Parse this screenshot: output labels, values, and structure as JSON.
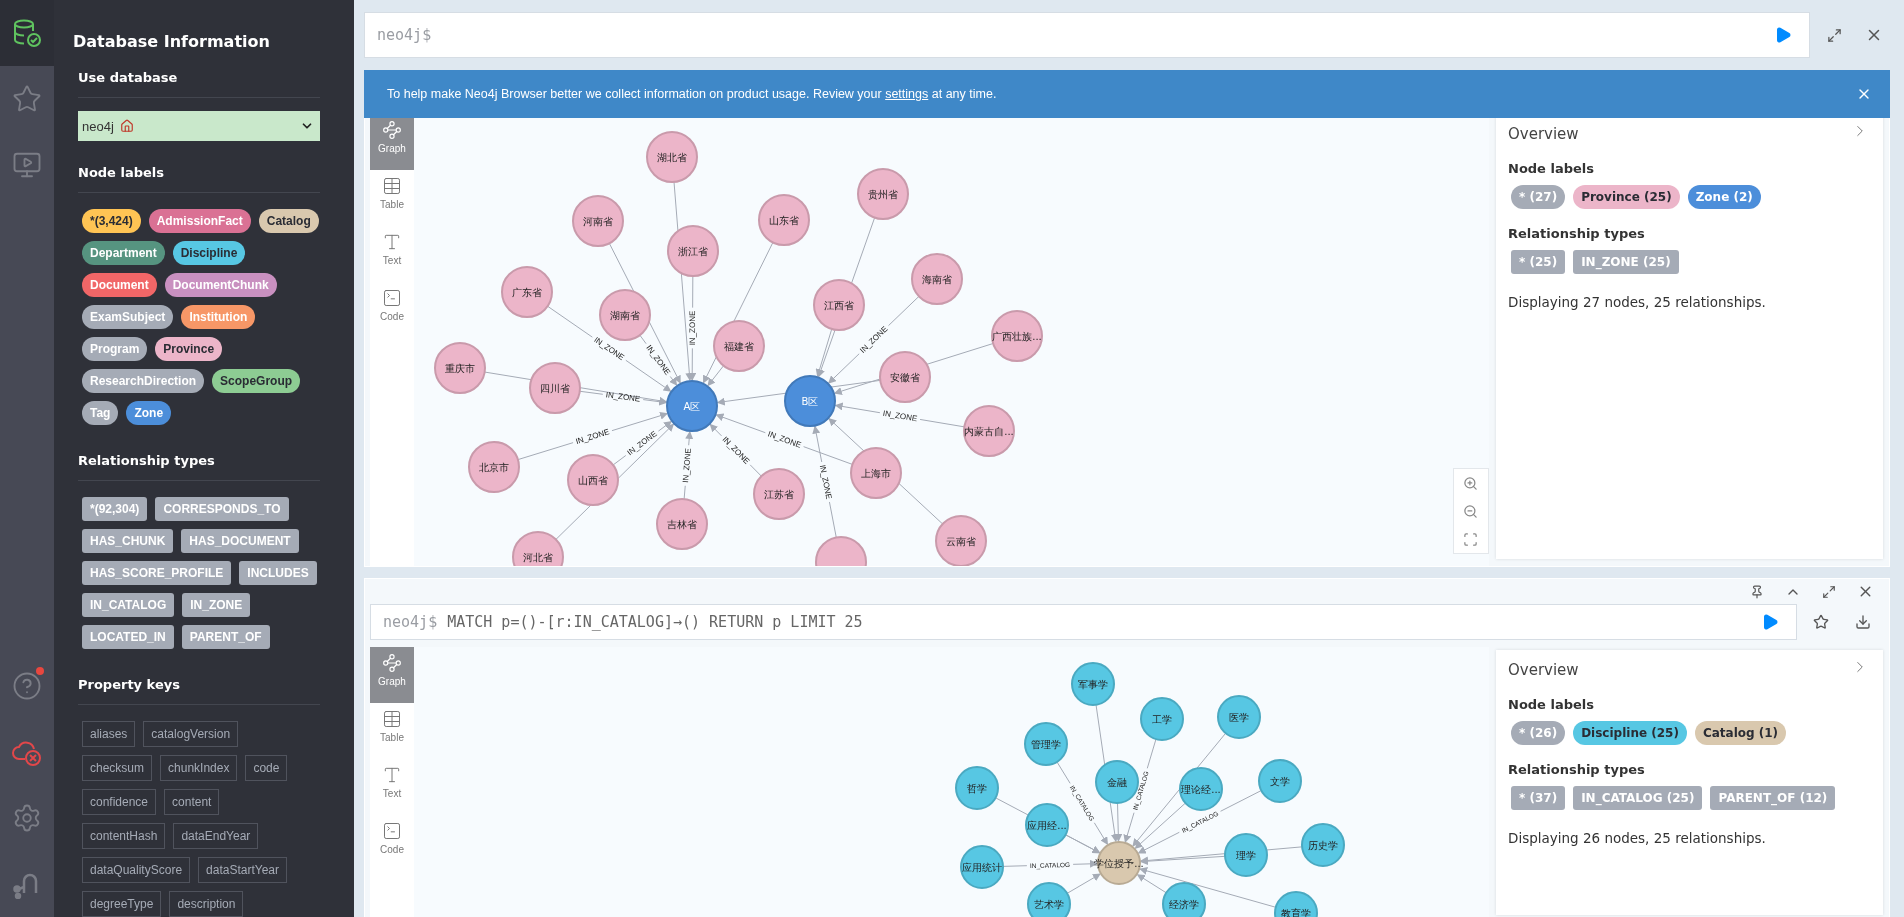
{
  "nav_items": [
    {
      "kind": "database",
      "selected": true,
      "notification": false
    },
    {
      "kind": "favorites",
      "selected": false,
      "notification": false
    },
    {
      "kind": "guides",
      "selected": false,
      "notification": false
    },
    {
      "kind": "help",
      "selected": false,
      "notification": true
    },
    {
      "kind": "connection",
      "selected": false,
      "notification": false
    },
    {
      "kind": "settings",
      "selected": false,
      "notification": false
    },
    {
      "kind": "sandbox",
      "selected": false,
      "notification": false
    }
  ],
  "drawer": {
    "title": "Database Information",
    "use_database": {
      "heading": "Use database",
      "value": "neo4j"
    },
    "node_labels": {
      "heading": "Node labels",
      "items": [
        {
          "label": "*(3,424)",
          "color": "#ffc454"
        },
        {
          "label": "AdmissionFact",
          "color": "#da7194"
        },
        {
          "label": "Catalog",
          "color": "#d9c8ae"
        },
        {
          "label": "Department",
          "color": "#569480"
        },
        {
          "label": "Discipline",
          "color": "#57c7e3"
        },
        {
          "label": "Document",
          "color": "#f16667"
        },
        {
          "label": "DocumentChunk",
          "color": "#c990c0"
        },
        {
          "label": "ExamSubject",
          "color": "#a5abb6"
        },
        {
          "label": "Institution",
          "color": "#f79767"
        },
        {
          "label": "Program",
          "color": "#a5abb6"
        },
        {
          "label": "Province",
          "color": "#ecb5c9"
        },
        {
          "label": "ResearchDirection",
          "color": "#a5abb6"
        },
        {
          "label": "ScopeGroup",
          "color": "#8dcc93"
        },
        {
          "label": "Tag",
          "color": "#a5abb6"
        },
        {
          "label": "Zone",
          "color": "#4c8eda"
        }
      ]
    },
    "relationship_types": {
      "heading": "Relationship types",
      "items": [
        "*(92,304)",
        "CORRESPONDS_TO",
        "HAS_CHUNK",
        "HAS_DOCUMENT",
        "HAS_SCORE_PROFILE",
        "INCLUDES",
        "IN_CATALOG",
        "IN_ZONE",
        "LOCATED_IN",
        "PARENT_OF"
      ]
    },
    "property_keys": {
      "heading": "Property keys",
      "items": [
        "aliases",
        "catalogVersion",
        "checksum",
        "chunkIndex",
        "code",
        "confidence",
        "content",
        "contentHash",
        "dataEndYear",
        "dataQualityScore",
        "dataStartYear",
        "degreeType",
        "description"
      ]
    }
  },
  "editor": {
    "prompt": "neo4j$"
  },
  "banner": {
    "text_before": "To help make Neo4j Browser better we collect information on product usage. Review your ",
    "link": "settings",
    "text_after": " at any time."
  },
  "frames": [
    {
      "view_tabs": [
        {
          "label": "Graph",
          "kind": "graph",
          "selected": true
        },
        {
          "label": "Table",
          "kind": "table",
          "selected": false
        },
        {
          "label": "Text",
          "kind": "text",
          "selected": false
        },
        {
          "label": "Code",
          "kind": "code",
          "selected": false
        }
      ],
      "graph": {
        "nodes": [
          {
            "label": "湖北省",
            "color": "#ecb5c9"
          },
          {
            "label": "河南省",
            "color": "#ecb5c9"
          },
          {
            "label": "浙江省",
            "color": "#ecb5c9",
            "edge_label": "IN_ZONE"
          },
          {
            "label": "山东省",
            "color": "#ecb5c9"
          },
          {
            "label": "贵州省",
            "color": "#ecb5c9"
          },
          {
            "label": "海南省",
            "color": "#ecb5c9",
            "edge_label": "IN_ZONE"
          },
          {
            "label": "广东省",
            "color": "#ecb5c9",
            "edge_label": "IN_ZONE"
          },
          {
            "label": "湖南省",
            "color": "#ecb5c9",
            "edge_label": "IN_ZONE"
          },
          {
            "label": "江西省",
            "color": "#ecb5c9"
          },
          {
            "label": "福建省",
            "color": "#ecb5c9"
          },
          {
            "label": "广西壮族...",
            "color": "#ecb5c9"
          },
          {
            "label": "重庆市",
            "color": "#ecb5c9"
          },
          {
            "label": "四川省",
            "color": "#ecb5c9",
            "edge_label": "IN_ZONE"
          },
          {
            "label": "A区",
            "color": "#4c8eda"
          },
          {
            "label": "B区",
            "color": "#4c8eda"
          },
          {
            "label": "安徽省",
            "color": "#ecb5c9"
          },
          {
            "label": "内蒙古自...",
            "color": "#ecb5c9",
            "edge_label": "IN_ZONE"
          },
          {
            "label": "北京市",
            "color": "#ecb5c9",
            "edge_label": "IN_ZONE"
          },
          {
            "label": "山西省",
            "color": "#ecb5c9",
            "edge_label": "IN_ZONE"
          },
          {
            "label": "上海市",
            "color": "#ecb5c9",
            "edge_label": "IN_ZONE"
          },
          {
            "label": "江苏省",
            "color": "#ecb5c9",
            "edge_label": "IN_ZONE"
          },
          {
            "label": "云南省",
            "color": "#ecb5c9"
          },
          {
            "label": "吉林省",
            "color": "#ecb5c9",
            "edge_label": "IN_ZONE"
          },
          {
            "label": "河北省",
            "color": "#ecb5c9"
          },
          {
            "color": "#ecb5c9",
            "edge_label": "IN_ZONE"
          }
        ]
      },
      "overview": {
        "title": "Overview",
        "node_labels_heading": "Node labels",
        "node_labels": [
          {
            "label": "* (27)",
            "color": "#a5abb6"
          },
          {
            "label": "Province (25)",
            "color": "#ecb5c9"
          },
          {
            "label": "Zone (2)",
            "color": "#4c8eda"
          }
        ],
        "relationship_types_heading": "Relationship types",
        "relationship_types": [
          "* (25)",
          "IN_ZONE (25)"
        ],
        "summary": "Displaying 27 nodes, 25 relationships."
      }
    },
    {
      "editor": {
        "prompt": "neo4j$",
        "query": "MATCH p=()-[r:IN_CATALOG]→() RETURN p LIMIT 25"
      },
      "view_tabs": [
        {
          "label": "Graph",
          "kind": "graph",
          "selected": true
        },
        {
          "label": "Table",
          "kind": "table",
          "selected": false
        },
        {
          "label": "Text",
          "kind": "text",
          "selected": false
        },
        {
          "label": "Code",
          "kind": "code",
          "selected": false
        }
      ],
      "graph": {
        "nodes": [
          {
            "label": "军事学",
            "color": "#57c7e3"
          },
          {
            "label": "工学",
            "color": "#57c7e3",
            "edge_label": "IN_CATALOG"
          },
          {
            "label": "医学",
            "color": "#57c7e3"
          },
          {
            "label": "管理学",
            "color": "#57c7e3",
            "edge_label": "IN_CATALOG"
          },
          {
            "label": "金融",
            "color": "#57c7e3"
          },
          {
            "label": "理论经...",
            "color": "#57c7e3"
          },
          {
            "label": "文学",
            "color": "#57c7e3",
            "edge_label": "IN_CATALOG"
          },
          {
            "label": "哲学",
            "color": "#57c7e3"
          },
          {
            "label": "应用经...",
            "color": "#57c7e3"
          },
          {
            "label": "理学",
            "color": "#57c7e3"
          },
          {
            "label": "历史学",
            "color": "#57c7e3"
          },
          {
            "label": "应用统计",
            "color": "#57c7e3",
            "edge_label": "IN_CATALOG"
          },
          {
            "label": "学位授予...",
            "color": "#d9c8ae"
          },
          {
            "label": "艺术学",
            "color": "#57c7e3"
          },
          {
            "label": "经济学",
            "color": "#57c7e3"
          },
          {
            "label": "教育学",
            "color": "#57c7e3"
          }
        ]
      },
      "overview": {
        "title": "Overview",
        "node_labels_heading": "Node labels",
        "node_labels": [
          {
            "label": "* (26)",
            "color": "#a5abb6"
          },
          {
            "label": "Discipline (25)",
            "color": "#57c7e3"
          },
          {
            "label": "Catalog (1)",
            "color": "#d9c8ae"
          }
        ],
        "relationship_types_heading": "Relationship types",
        "relationship_types": [
          "* (37)",
          "IN_CATALOG (25)",
          "PARENT_OF (12)"
        ],
        "summary": "Displaying 26 nodes, 25 relationships."
      }
    }
  ]
}
